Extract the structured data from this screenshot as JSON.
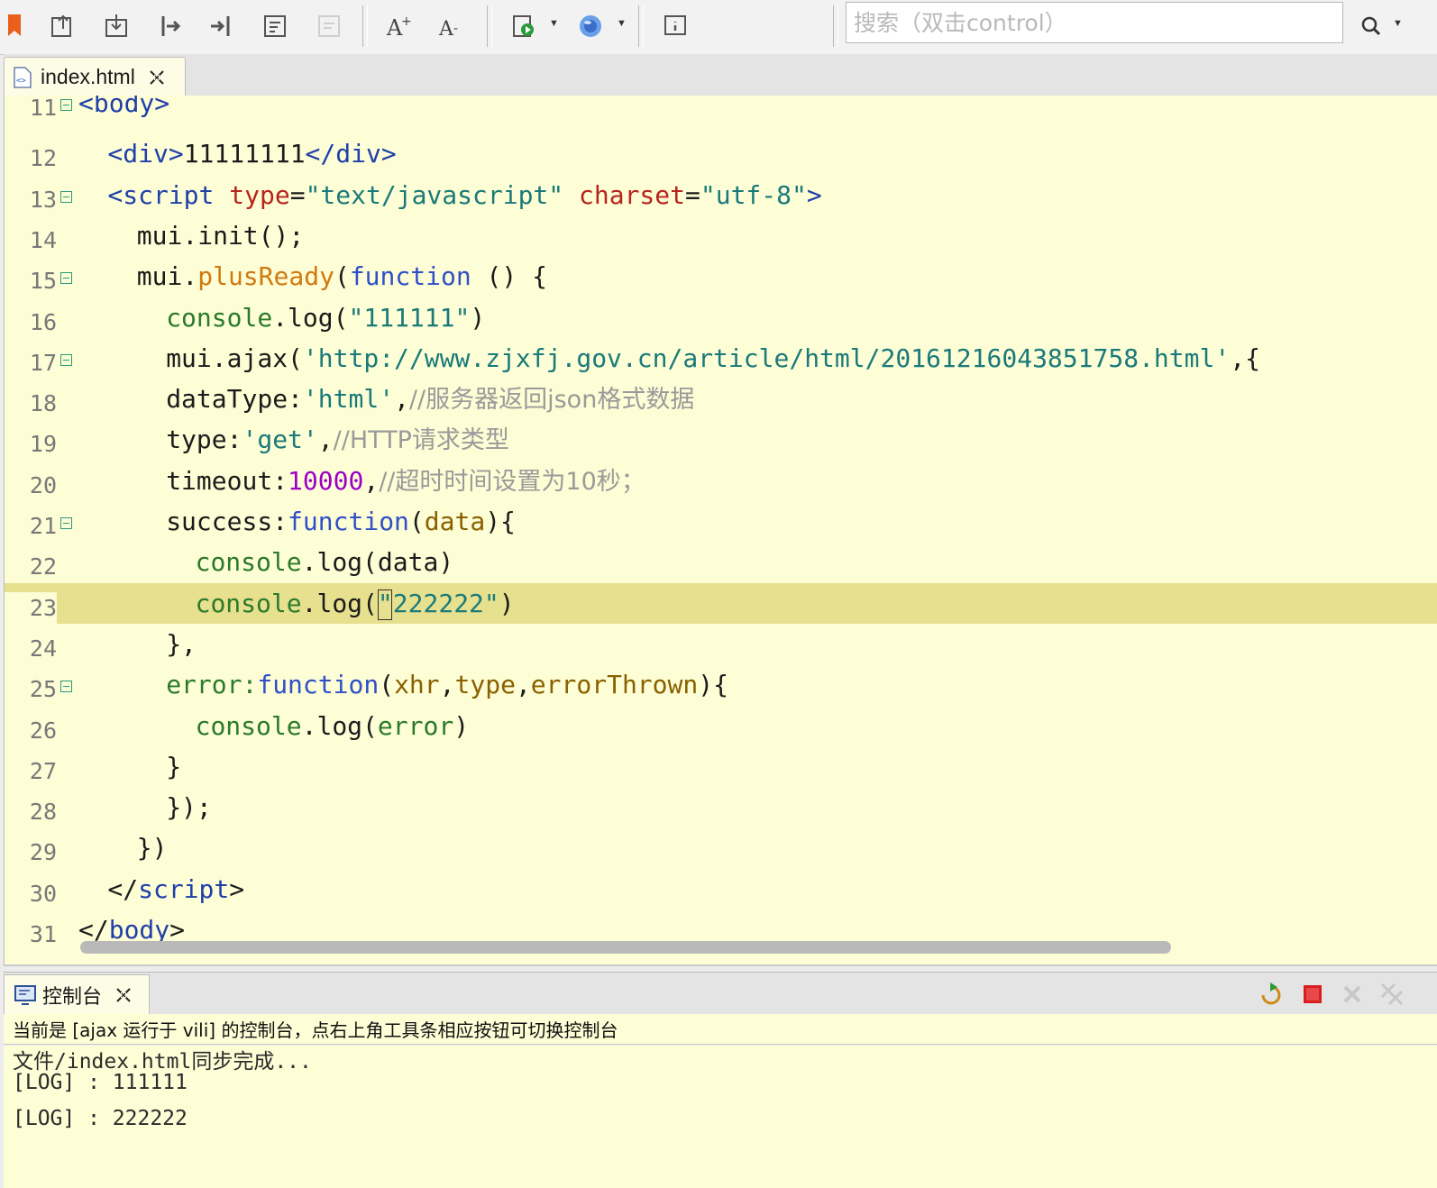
{
  "toolbar": {
    "buttons": [
      {
        "name": "bookmark-icon",
        "glyph": "▮"
      },
      {
        "name": "export-icon"
      },
      {
        "name": "import-icon"
      },
      {
        "name": "step-into-icon"
      },
      {
        "name": "step-out-icon"
      },
      {
        "name": "format-icon"
      },
      {
        "name": "disabled-doc-icon"
      },
      {
        "name": "font-increase-icon",
        "glyph": "A+"
      },
      {
        "name": "font-decrease-icon",
        "glyph": "A-"
      },
      {
        "name": "run-icon"
      },
      {
        "name": "browser-icon"
      },
      {
        "name": "info-icon",
        "glyph": "i"
      }
    ],
    "search": {
      "placeholder": "搜索（双击control）"
    },
    "search_icon": "magnifier-icon"
  },
  "editor": {
    "tab_label": "index.html",
    "lines": [
      {
        "n": "11",
        "fold": true
      },
      {
        "n": "12"
      },
      {
        "n": "13",
        "fold": true
      },
      {
        "n": "14"
      },
      {
        "n": "15",
        "fold": true
      },
      {
        "n": "16"
      },
      {
        "n": "17",
        "fold": true
      },
      {
        "n": "18"
      },
      {
        "n": "19"
      },
      {
        "n": "20"
      },
      {
        "n": "21",
        "fold": true
      },
      {
        "n": "22"
      },
      {
        "n": "23",
        "current": true
      },
      {
        "n": "24"
      },
      {
        "n": "25",
        "fold": true
      },
      {
        "n": "26"
      },
      {
        "n": "27"
      },
      {
        "n": "28"
      },
      {
        "n": "29"
      },
      {
        "n": "30"
      },
      {
        "n": "31"
      }
    ],
    "code": {
      "l11": [
        "<body>"
      ],
      "l12": [
        "<div>",
        "11111111",
        "</div>"
      ],
      "l13": [
        "<script",
        " type",
        "=",
        "\"text/javascript\"",
        " charset",
        "=",
        "\"utf-8\"",
        ">"
      ],
      "l14": [
        "mui.init();"
      ],
      "l15": [
        "mui.",
        "plusReady",
        "(",
        "function",
        " () {"
      ],
      "l16": [
        "console",
        ".log(",
        "\"111111\"",
        ")"
      ],
      "l17": [
        "mui.ajax(",
        "'http://www.zjxfj.gov.cn/article/html/20161216043851758.html'",
        ",{"
      ],
      "l18": [
        "dataType:",
        "'html'",
        ",",
        "//服务器返回json格式数据"
      ],
      "l19": [
        "type:",
        "'get'",
        ",",
        "//HTTP请求类型"
      ],
      "l20": [
        "timeout:",
        "10000",
        ",",
        "//超时时间设置为10秒；"
      ],
      "l21": [
        "success:",
        "function",
        "(",
        "data",
        "){"
      ],
      "l22": [
        "console",
        ".log(data)"
      ],
      "l23": [
        "console",
        ".log(",
        "\"222222\"",
        ")"
      ],
      "l24": [
        "},"
      ],
      "l25": [
        "error:",
        "function",
        "(",
        "xhr",
        ",",
        "type",
        ",",
        "errorThrown",
        "){"
      ],
      "l26": [
        "console",
        ".log(",
        "error",
        ")"
      ],
      "l27": [
        "}"
      ],
      "l28": [
        "});"
      ],
      "l29": [
        "})"
      ],
      "l30": [
        "</",
        "script",
        ">"
      ],
      "l31": [
        "</",
        "body",
        ">"
      ]
    }
  },
  "console": {
    "tab_label": "控制台",
    "header": "当前是 [ajax 运行于 vili] 的控制台，点右上角工具条相应按钮可切换控制台",
    "output": [
      "文件/index.html同步完成...",
      "[LOG] : 111111",
      "[LOG] : 222222"
    ]
  },
  "colors": {
    "editor_bg": "#fdfdd6",
    "current_line": "#e6e08f",
    "tag": "#2040a8",
    "attribute": "#b7241c",
    "string": "#1a7a7a",
    "keyword": "#3050c8",
    "number": "#9a00c8",
    "comment": "#9a9a9a"
  }
}
